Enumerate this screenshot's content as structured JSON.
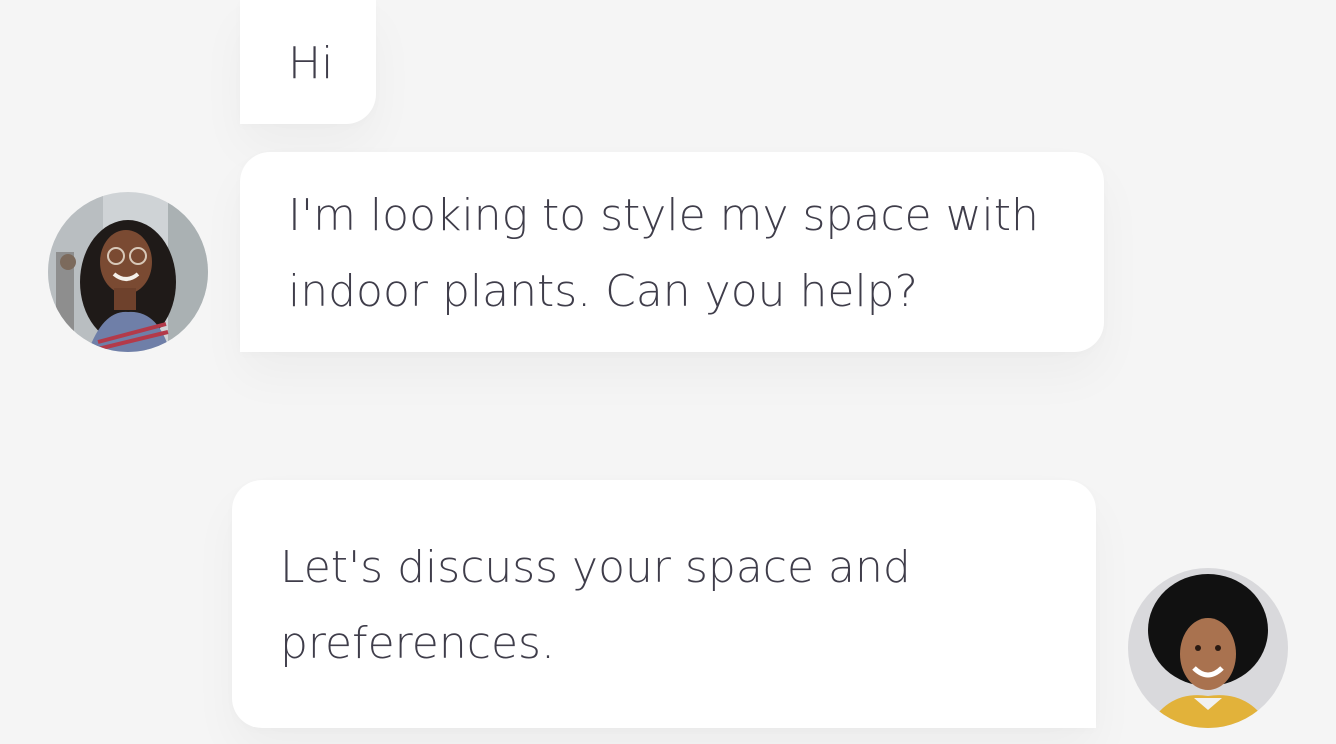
{
  "chat": {
    "messages": [
      {
        "sender": "user",
        "text": "Hi"
      },
      {
        "sender": "user",
        "text": "I'm looking to style my space with indoor plants. Can you help?"
      },
      {
        "sender": "assistant",
        "text": "Let's discuss your space and preferences."
      }
    ],
    "avatars": {
      "user": "user-avatar-photo",
      "assistant": "assistant-avatar-photo"
    }
  }
}
